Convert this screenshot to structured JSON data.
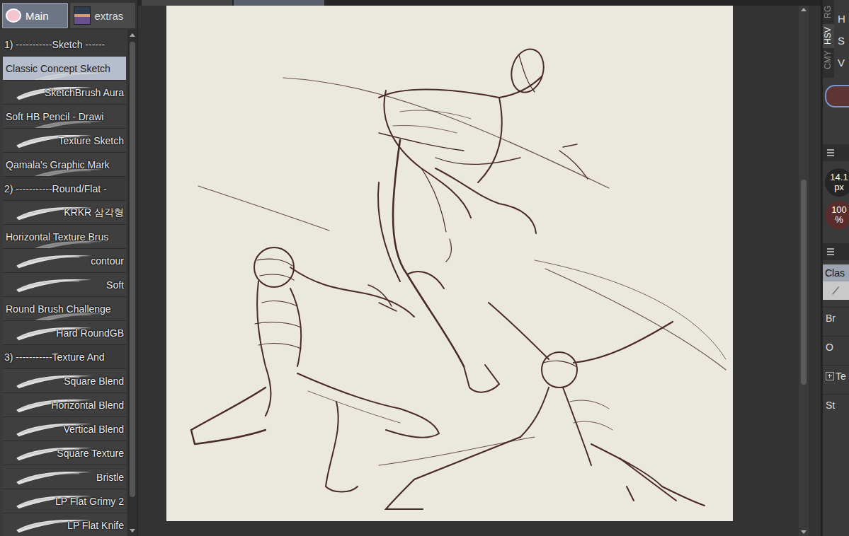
{
  "palette_tabs": [
    {
      "label": "Main",
      "selected": true
    },
    {
      "label": "extras",
      "selected": false
    }
  ],
  "brushes": [
    {
      "label": "1) -----------Sketch ------",
      "kind": "header",
      "selected": false
    },
    {
      "label": "Classic Concept Sketch",
      "kind": "named",
      "selected": true
    },
    {
      "label": "SketchBrush Aura",
      "kind": "preview",
      "selected": false
    },
    {
      "label": "Soft HB  Pencil - Drawi",
      "kind": "named",
      "selected": false
    },
    {
      "label": "Texture Sketch",
      "kind": "preview",
      "selected": false
    },
    {
      "label": "Qamala's Graphic Mark",
      "kind": "named",
      "selected": false
    },
    {
      "label": "2) -----------Round/Flat -",
      "kind": "header",
      "selected": false
    },
    {
      "label": "KRKR 삼각형",
      "kind": "preview",
      "selected": false
    },
    {
      "label": "Horizontal Texture Brus",
      "kind": "named",
      "selected": false
    },
    {
      "label": "contour",
      "kind": "preview",
      "selected": false
    },
    {
      "label": "Soft",
      "kind": "preview",
      "selected": false
    },
    {
      "label": "Round Brush Challenge",
      "kind": "named",
      "selected": false
    },
    {
      "label": "Hard RoundGB",
      "kind": "preview",
      "selected": false
    },
    {
      "label": "3) -----------Texture And",
      "kind": "header",
      "selected": false
    },
    {
      "label": "Square Blend",
      "kind": "preview",
      "selected": false
    },
    {
      "label": "Horizontal Blend",
      "kind": "preview",
      "selected": false
    },
    {
      "label": "Vertical Blend",
      "kind": "preview",
      "selected": false
    },
    {
      "label": "Square Texture",
      "kind": "preview",
      "selected": false
    },
    {
      "label": "Bristle",
      "kind": "preview",
      "selected": false
    },
    {
      "label": "LP Flat Grimy 2",
      "kind": "preview",
      "selected": false
    },
    {
      "label": "LP Flat Knife",
      "kind": "preview",
      "selected": false
    }
  ],
  "color_panel": {
    "modes": [
      {
        "label": "RG",
        "selected": false
      },
      {
        "label": "HSV",
        "selected": true
      },
      {
        "label": "CMY",
        "selected": false
      }
    ],
    "channels": [
      "H",
      "S",
      "V"
    ],
    "color": "#5e3535"
  },
  "brush_size": {
    "value": "14.1",
    "unit": "px"
  },
  "opacity": {
    "value": "100",
    "unit": "%"
  },
  "tool_property": {
    "title": "Clas",
    "rows": [
      {
        "label": "Br",
        "expandable": false
      },
      {
        "label": "O",
        "expandable": false
      },
      {
        "label": "Te",
        "expandable": true
      },
      {
        "label": "St",
        "expandable": false
      }
    ]
  }
}
